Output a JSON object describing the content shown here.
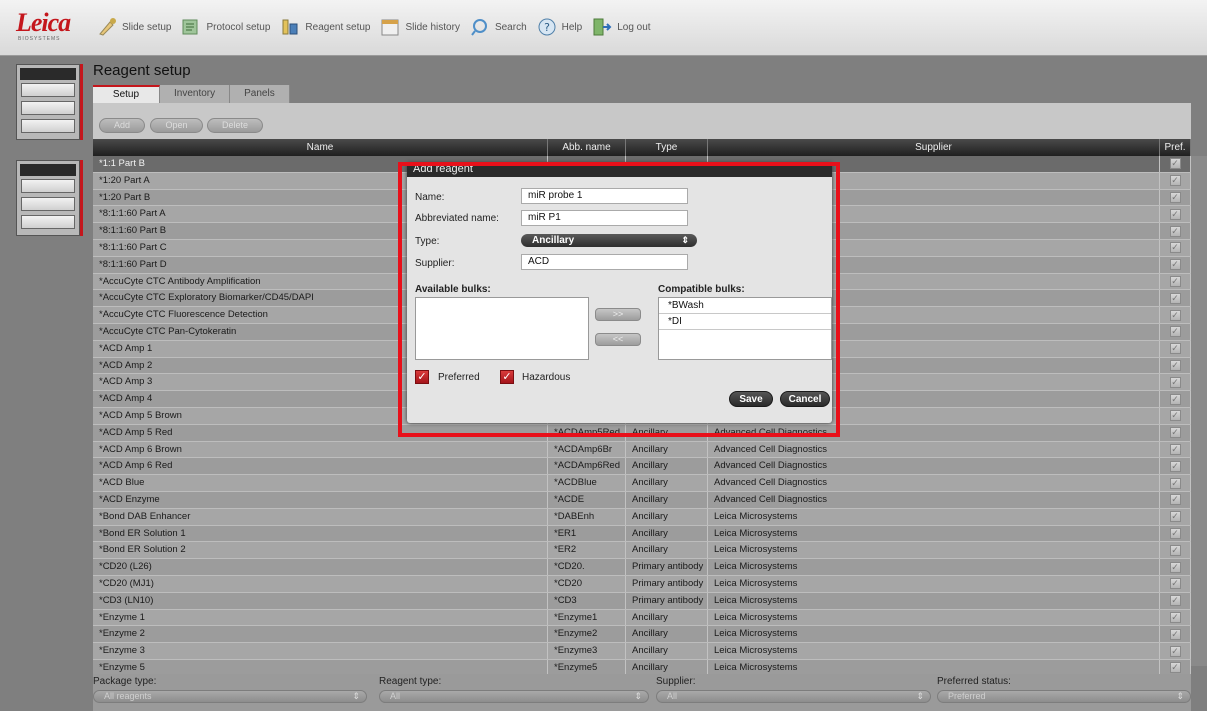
{
  "brand": {
    "name": "Leica",
    "sub": "BIOSYSTEMS"
  },
  "nav": [
    {
      "label": "Slide setup",
      "icon": "pipette-icon"
    },
    {
      "label": "Protocol setup",
      "icon": "protocol-icon"
    },
    {
      "label": "Reagent setup",
      "icon": "reagent-icon"
    },
    {
      "label": "Slide history",
      "icon": "calendar-icon"
    },
    {
      "label": "Search",
      "icon": "search-icon"
    },
    {
      "label": "Help",
      "icon": "help-icon"
    },
    {
      "label": "Log out",
      "icon": "logout-icon"
    }
  ],
  "page": {
    "title": "Reagent setup",
    "tabs": [
      "Setup",
      "Inventory",
      "Panels"
    ],
    "toolbar": {
      "add": "Add",
      "open": "Open",
      "delete": "Delete"
    }
  },
  "table": {
    "headers": {
      "name": "Name",
      "abb": "Abb. name",
      "type": "Type",
      "supplier": "Supplier",
      "pref": "Pref."
    },
    "rows": [
      {
        "name": "*1:1 Part B",
        "abb": "",
        "type": "",
        "supplier": ""
      },
      {
        "name": "*1:20 Part A",
        "abb": "",
        "type": "",
        "supplier": ""
      },
      {
        "name": "*1:20 Part B",
        "abb": "",
        "type": "",
        "supplier": ""
      },
      {
        "name": "*8:1:1:60 Part A",
        "abb": "",
        "type": "",
        "supplier": ""
      },
      {
        "name": "*8:1:1:60 Part B",
        "abb": "",
        "type": "",
        "supplier": ""
      },
      {
        "name": "*8:1:1:60 Part C",
        "abb": "",
        "type": "",
        "supplier": ""
      },
      {
        "name": "*8:1:1:60 Part D",
        "abb": "",
        "type": "",
        "supplier": ""
      },
      {
        "name": "*AccuCyte CTC Antibody Amplification",
        "abb": "",
        "type": "",
        "supplier": ""
      },
      {
        "name": "*AccuCyte CTC Exploratory Biomarker/CD45/DAPI",
        "abb": "",
        "type": "",
        "supplier": ""
      },
      {
        "name": "*AccuCyte CTC Fluorescence Detection",
        "abb": "",
        "type": "",
        "supplier": ""
      },
      {
        "name": "*AccuCyte CTC Pan-Cytokeratin",
        "abb": "",
        "type": "",
        "supplier": ""
      },
      {
        "name": "*ACD Amp 1",
        "abb": "",
        "type": "",
        "supplier": ""
      },
      {
        "name": "*ACD Amp 2",
        "abb": "",
        "type": "",
        "supplier": ""
      },
      {
        "name": "*ACD Amp 3",
        "abb": "",
        "type": "",
        "supplier": ""
      },
      {
        "name": "*ACD Amp 4",
        "abb": "",
        "type": "",
        "supplier": ""
      },
      {
        "name": "*ACD Amp 5 Brown",
        "abb": "",
        "type": "",
        "supplier": ""
      },
      {
        "name": "*ACD Amp 5 Red",
        "abb": "*ACDAmp5Red",
        "type": "Ancillary",
        "supplier": "Advanced Cell Diagnostics"
      },
      {
        "name": "*ACD Amp 6 Brown",
        "abb": "*ACDAmp6Br",
        "type": "Ancillary",
        "supplier": "Advanced Cell Diagnostics"
      },
      {
        "name": "*ACD Amp 6 Red",
        "abb": "*ACDAmp6Red",
        "type": "Ancillary",
        "supplier": "Advanced Cell Diagnostics"
      },
      {
        "name": "*ACD Blue",
        "abb": "*ACDBlue",
        "type": "Ancillary",
        "supplier": "Advanced Cell Diagnostics"
      },
      {
        "name": "*ACD Enzyme",
        "abb": "*ACDE",
        "type": "Ancillary",
        "supplier": "Advanced Cell Diagnostics"
      },
      {
        "name": "*Bond DAB Enhancer",
        "abb": "*DABEnh",
        "type": "Ancillary",
        "supplier": "Leica Microsystems"
      },
      {
        "name": "*Bond ER Solution 1",
        "abb": "*ER1",
        "type": "Ancillary",
        "supplier": "Leica Microsystems"
      },
      {
        "name": "*Bond ER Solution 2",
        "abb": "*ER2",
        "type": "Ancillary",
        "supplier": "Leica Microsystems"
      },
      {
        "name": "*CD20 (L26)",
        "abb": "*CD20.",
        "type": "Primary antibody",
        "supplier": "Leica Microsystems"
      },
      {
        "name": "*CD20 (MJ1)",
        "abb": "*CD20",
        "type": "Primary antibody",
        "supplier": "Leica Microsystems"
      },
      {
        "name": "*CD3 (LN10)",
        "abb": "*CD3",
        "type": "Primary antibody",
        "supplier": "Leica Microsystems"
      },
      {
        "name": "*Enzyme 1",
        "abb": "*Enzyme1",
        "type": "Ancillary",
        "supplier": "Leica Microsystems"
      },
      {
        "name": "*Enzyme 2",
        "abb": "*Enzyme2",
        "type": "Ancillary",
        "supplier": "Leica Microsystems"
      },
      {
        "name": "*Enzyme 3",
        "abb": "*Enzyme3",
        "type": "Ancillary",
        "supplier": "Leica Microsystems"
      },
      {
        "name": "*Enzyme 5",
        "abb": "*Enzyme5",
        "type": "Ancillary",
        "supplier": "Leica Microsystems"
      }
    ]
  },
  "filters": {
    "package_label": "Package type:",
    "package_value": "All reagents",
    "reagent_label": "Reagent type:",
    "reagent_value": "All",
    "supplier_label": "Supplier:",
    "supplier_value": "All",
    "pref_label": "Preferred status:",
    "pref_value": "Preferred"
  },
  "dialog": {
    "title": "Add reagent",
    "name_label": "Name:",
    "name_value": "miR probe 1",
    "abbr_label": "Abbreviated name:",
    "abbr_value": "miR P1",
    "type_label": "Type:",
    "type_value": "Ancillary",
    "supplier_label": "Supplier:",
    "supplier_value": "ACD",
    "available_label": "Available bulks:",
    "compatible_label": "Compatible bulks:",
    "compatible": [
      "*BWash",
      "*DI"
    ],
    "move_right": ">>",
    "move_left": "<<",
    "preferred_label": "Preferred",
    "hazardous_label": "Hazardous",
    "save": "Save",
    "cancel": "Cancel"
  },
  "colors": {
    "accent": "#c4161c",
    "highlight": "#e8101a"
  }
}
